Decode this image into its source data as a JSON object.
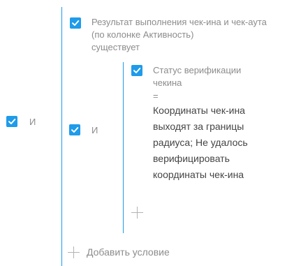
{
  "colors": {
    "accent": "#1f9bea",
    "muted_text": "#8c8c8c",
    "dark_text": "#444444",
    "plus": "#b3b3b3"
  },
  "outer_group": {
    "checked": true,
    "operator": "И"
  },
  "inner_group": {
    "checked": true,
    "operator": "И"
  },
  "condition_1": {
    "checked": true,
    "lines": [
      "Результат выполнения чек-ина и чек-аута",
      "(по колонке Активность)",
      "существует"
    ]
  },
  "condition_2": {
    "checked": true,
    "column_lines": [
      "Статус верификации",
      "чекина"
    ],
    "comparison": "=",
    "value_lines": [
      "Координаты чек-ина",
      "выходят за границы",
      "радиуса; Не удалось",
      "верифицировать",
      "координаты чек-ина"
    ]
  },
  "inner_add_icon": "plus-icon",
  "add_condition": {
    "icon": "plus-icon",
    "label": "Добавить условие"
  }
}
